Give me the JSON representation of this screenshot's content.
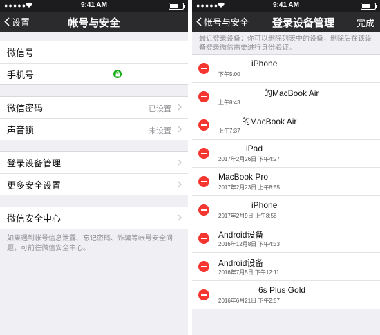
{
  "status": {
    "time": "9:41 AM"
  },
  "left": {
    "nav": {
      "back": "设置",
      "title": "帐号与安全"
    },
    "group1": [
      {
        "label": "微信号"
      },
      {
        "label": "手机号"
      }
    ],
    "group2": [
      {
        "label": "微信密码",
        "value": "已设置"
      },
      {
        "label": "声音锁",
        "value": "未设置"
      }
    ],
    "group3": [
      {
        "label": "登录设备管理"
      },
      {
        "label": "更多安全设置"
      }
    ],
    "group4": [
      {
        "label": "微信安全中心"
      }
    ],
    "footnote": "如果遇到帐号信息泄露、忘记密码、诈骗等帐号安全问题，可前往微信安全中心。"
  },
  "right": {
    "nav": {
      "back": "帐号与安全",
      "title": "登录设备管理",
      "done": "完成"
    },
    "hint": "最近登录设备：你可以删除列表中的设备，删除后在该设备登录微信需要进行身份验证。",
    "devices": [
      {
        "name": "iPhone",
        "date": "下午5:00"
      },
      {
        "name": "的MacBook Air",
        "date": "上午8:43"
      },
      {
        "name": "的MacBook Air",
        "date": "上午7:37"
      },
      {
        "name": "iPad",
        "date": "2017年2月26日 下午4:27"
      },
      {
        "name": "MacBook Pro",
        "date": "2017年2月23日 上午8:55"
      },
      {
        "name": "iPhone",
        "date": "2017年2月9日 上午8:58"
      },
      {
        "name": "Android设备",
        "date": "2016年12月8日 下午4:33"
      },
      {
        "name": "Android设备",
        "date": "2016年7月5日 下午12:11"
      },
      {
        "name": "6s Plus Gold",
        "date": "2016年6月21日 下午2:57"
      }
    ]
  }
}
